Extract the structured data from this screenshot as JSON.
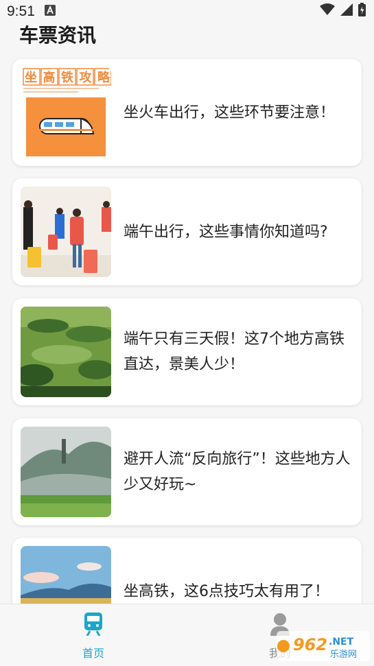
{
  "status_bar": {
    "time": "9:51",
    "icons": [
      "notification-a-icon",
      "wifi-icon",
      "signal-icon",
      "battery-icon"
    ]
  },
  "page": {
    "title": "车票资讯"
  },
  "articles": [
    {
      "title": "坐火车出行，这些环节要注意！",
      "thumbnail": "high-speed-train-guide",
      "thumbnail_banner": "坐高铁攻略"
    },
    {
      "title": "端午出行，这些事情你知道吗?",
      "thumbnail": "travelers-with-luggage"
    },
    {
      "title": "端午只有三天假！这7个地方高铁直达，景美人少！",
      "thumbnail": "green-countryside"
    },
    {
      "title": "避开人流“反向旅行”！这些地方人少又好玩~",
      "thumbnail": "misty-mountains"
    },
    {
      "title": "坐高铁，这6点技巧太有用了！",
      "thumbnail": "sky-and-hills"
    }
  ],
  "bottom_nav": {
    "items": [
      {
        "label": "首页",
        "icon": "train-icon",
        "active": true
      },
      {
        "label": "我的",
        "icon": "person-icon",
        "active": false
      }
    ]
  },
  "colors": {
    "accent": "#1aa7c9",
    "inactive": "#888888",
    "background": "#f6f6f6",
    "card": "#ffffff"
  },
  "watermark": {
    "text": "962.NET",
    "subtext": "乐游网"
  }
}
